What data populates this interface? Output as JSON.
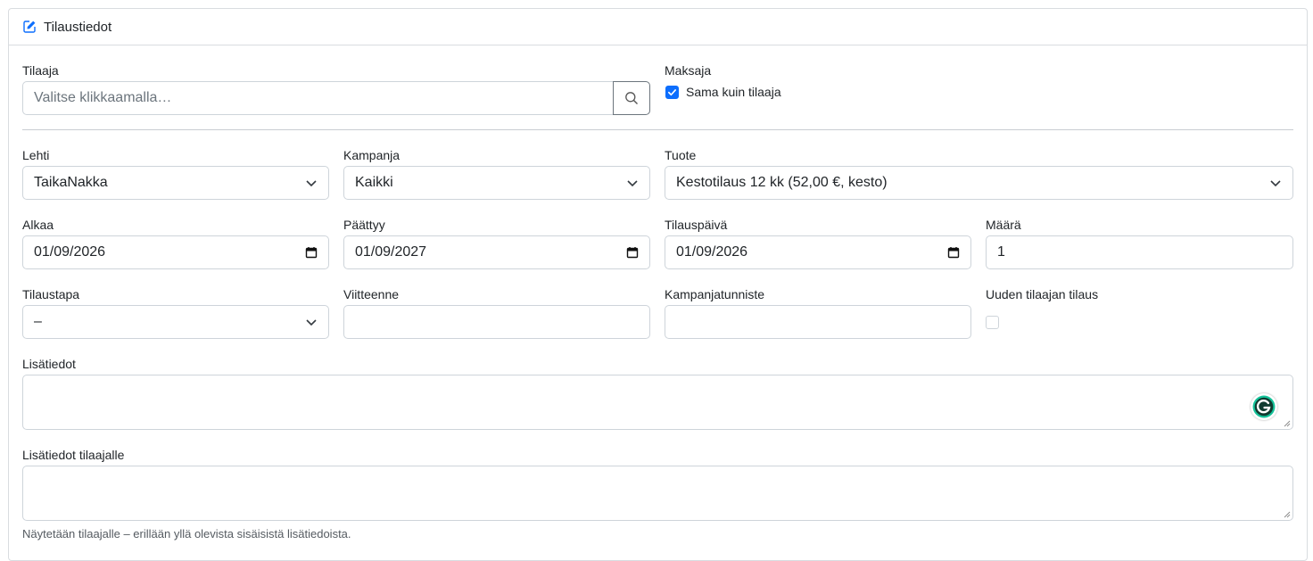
{
  "header": {
    "title": "Tilaustiedot",
    "icon": "edit-icon"
  },
  "tilaaja": {
    "label": "Tilaaja",
    "placeholder": "Valitse klikkaamalla…",
    "search_icon": "search-icon"
  },
  "maksaja": {
    "label": "Maksaja",
    "checkbox_label": "Sama kuin tilaaja",
    "checked": true
  },
  "lehti": {
    "label": "Lehti",
    "value": "TaikaNakka"
  },
  "kampanja": {
    "label": "Kampanja",
    "value": "Kaikki"
  },
  "tuote": {
    "label": "Tuote",
    "value": "Kestotilaus 12 kk (52,00 €, kesto)"
  },
  "alkaa": {
    "label": "Alkaa",
    "value": "01/09/2026"
  },
  "paattyy": {
    "label": "Päättyy",
    "value": "01/09/2027"
  },
  "tilauspaiva": {
    "label": "Tilauspäivä",
    "value": "01/09/2026"
  },
  "maara": {
    "label": "Määrä",
    "value": "1"
  },
  "tilaustapa": {
    "label": "Tilaustapa",
    "value": "–"
  },
  "viitteenne": {
    "label": "Viitteenne",
    "value": ""
  },
  "kampanjatunniste": {
    "label": "Kampanjatunniste",
    "value": ""
  },
  "uuden_tilaajan": {
    "label": "Uuden tilaajan tilaus",
    "checked": false
  },
  "lisatiedot": {
    "label": "Lisätiedot",
    "value": ""
  },
  "lisatiedot_tilaajalle": {
    "label": "Lisätiedot tilaajalle",
    "value": "",
    "help": "Näytetään tilaajalle – erillään yllä olevista sisäisistä lisätiedoista."
  },
  "colors": {
    "accent": "#0d6efd",
    "grammarly": "#15c39a"
  }
}
